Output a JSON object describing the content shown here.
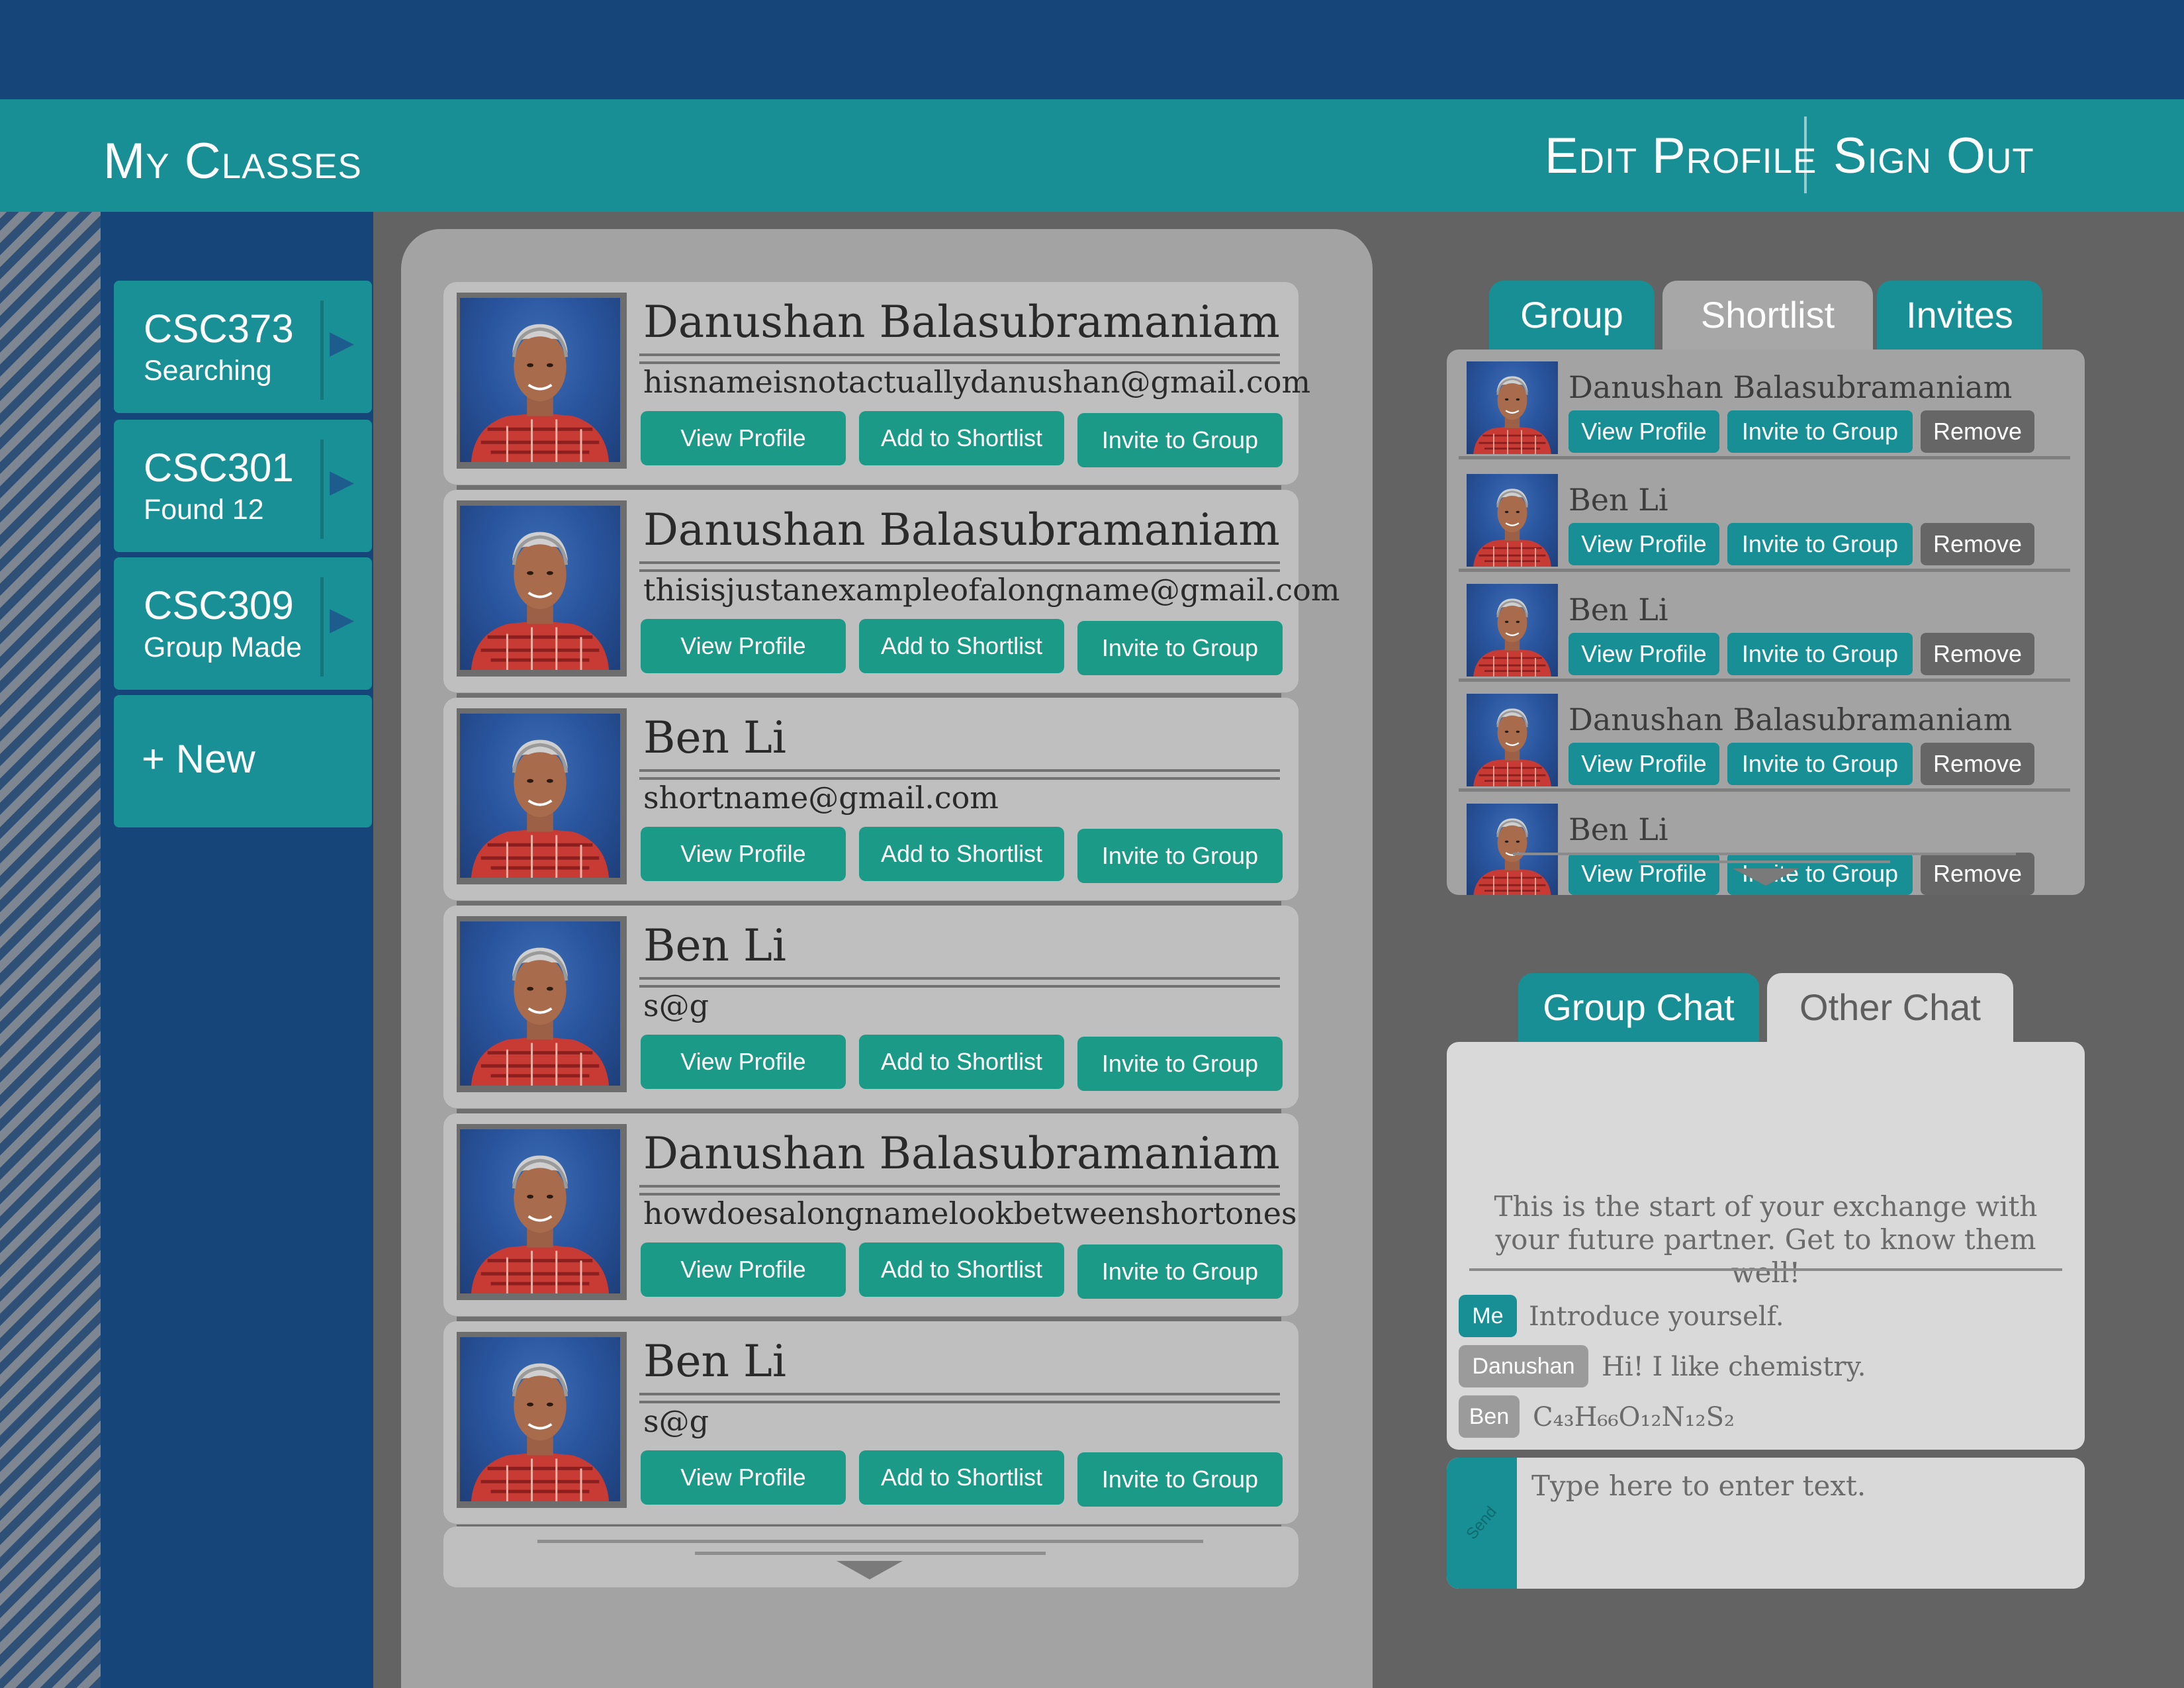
{
  "header": {
    "title": "My Classes",
    "edit_profile": "Edit Profile",
    "sign_out": "Sign Out"
  },
  "sidebar": {
    "classes": [
      {
        "code": "CSC373",
        "status": "Searching"
      },
      {
        "code": "CSC301",
        "status": "Found 12"
      },
      {
        "code": "CSC309",
        "status": "Group Made"
      }
    ],
    "new_label": "+ New"
  },
  "search_results": [
    {
      "name": "Danushan Balasubramaniam",
      "email": "hisnameisnotactuallydanushan@gmail.com"
    },
    {
      "name": "Danushan Balasubramaniam",
      "email": "thisisjustanexampleofalongname@gmail.com"
    },
    {
      "name": "Ben Li",
      "email": "shortname@gmail.com"
    },
    {
      "name": "Ben Li",
      "email": "s@g"
    },
    {
      "name": "Danushan Balasubramaniam",
      "email": "howdoesalongnamelookbetweenshortones"
    },
    {
      "name": "Ben Li",
      "email": "s@g"
    }
  ],
  "result_buttons": {
    "view_profile": "View Profile",
    "add_shortlist": "Add to Shortlist",
    "invite_group": "Invite to Group"
  },
  "list_tabs": [
    "Group",
    "Shortlist",
    "Invites"
  ],
  "shortlist": [
    {
      "name": "Danushan Balasubramaniam"
    },
    {
      "name": "Ben Li"
    },
    {
      "name": "Ben Li"
    },
    {
      "name": "Danushan Balasubramaniam"
    },
    {
      "name": "Ben Li"
    }
  ],
  "shortlist_buttons": {
    "view_profile": "View Profile",
    "invite_group": "Invite to Group",
    "remove": "Remove"
  },
  "chat_tabs": [
    "Group Chat",
    "Other Chat"
  ],
  "chat": {
    "intro": "This is the start of your exchange with your future partner. Get to know them well!",
    "messages": [
      {
        "sender": "Me",
        "text": "Introduce yourself."
      },
      {
        "sender": "Danushan",
        "text": "Hi! I like chemistry."
      },
      {
        "sender": "Ben",
        "text": "C₄₃H₆₆O₁₂N₁₂S₂"
      }
    ],
    "send_label": "Send",
    "input_placeholder": "Type here to enter text."
  },
  "colors": {
    "navy": "#154579",
    "teal": "#188f94",
    "green_button": "#1b9a87",
    "grey_background": "#636363",
    "panel_grey": "#a3a3a3",
    "card_grey": "#bfbfbf",
    "remove_grey": "#666666"
  }
}
